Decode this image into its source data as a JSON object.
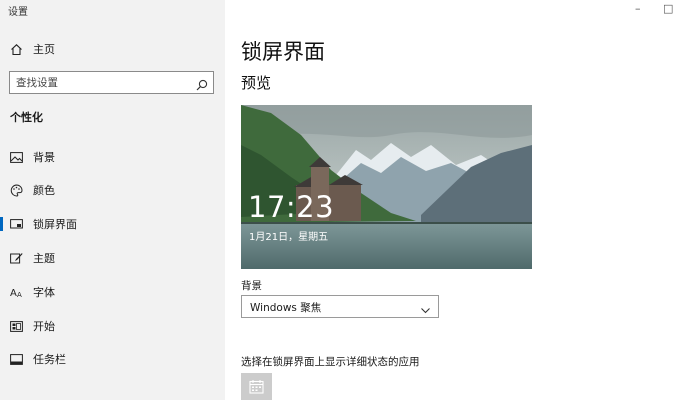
{
  "window": {
    "title": "设置",
    "minimize_glyph": "–",
    "maximize_glyph": "□"
  },
  "sidebar": {
    "home_label": "主页",
    "search_placeholder": "查找设置",
    "section_heading": "个性化",
    "items": [
      {
        "label": "背景",
        "icon": "image-icon"
      },
      {
        "label": "颜色",
        "icon": "palette-icon"
      },
      {
        "label": "锁屏界面",
        "icon": "lock-screen-icon",
        "active": true
      },
      {
        "label": "主题",
        "icon": "brush-icon"
      },
      {
        "label": "字体",
        "icon": "font-icon"
      },
      {
        "label": "开始",
        "icon": "start-icon"
      },
      {
        "label": "任务栏",
        "icon": "taskbar-icon"
      }
    ]
  },
  "main": {
    "title": "锁屏界面",
    "preview_heading": "预览",
    "preview_time": "17:23",
    "preview_date": "1月21日，星期五",
    "background_label": "背景",
    "background_value": "Windows 聚焦",
    "detailed_app_label": "选择在锁屏界面上显示详细状态的应用",
    "detailed_app_icon": "calendar-icon"
  },
  "colors": {
    "accent": "#0067c0",
    "sidebar_bg": "#f2f2f2",
    "tile_bg": "#cccccc"
  }
}
